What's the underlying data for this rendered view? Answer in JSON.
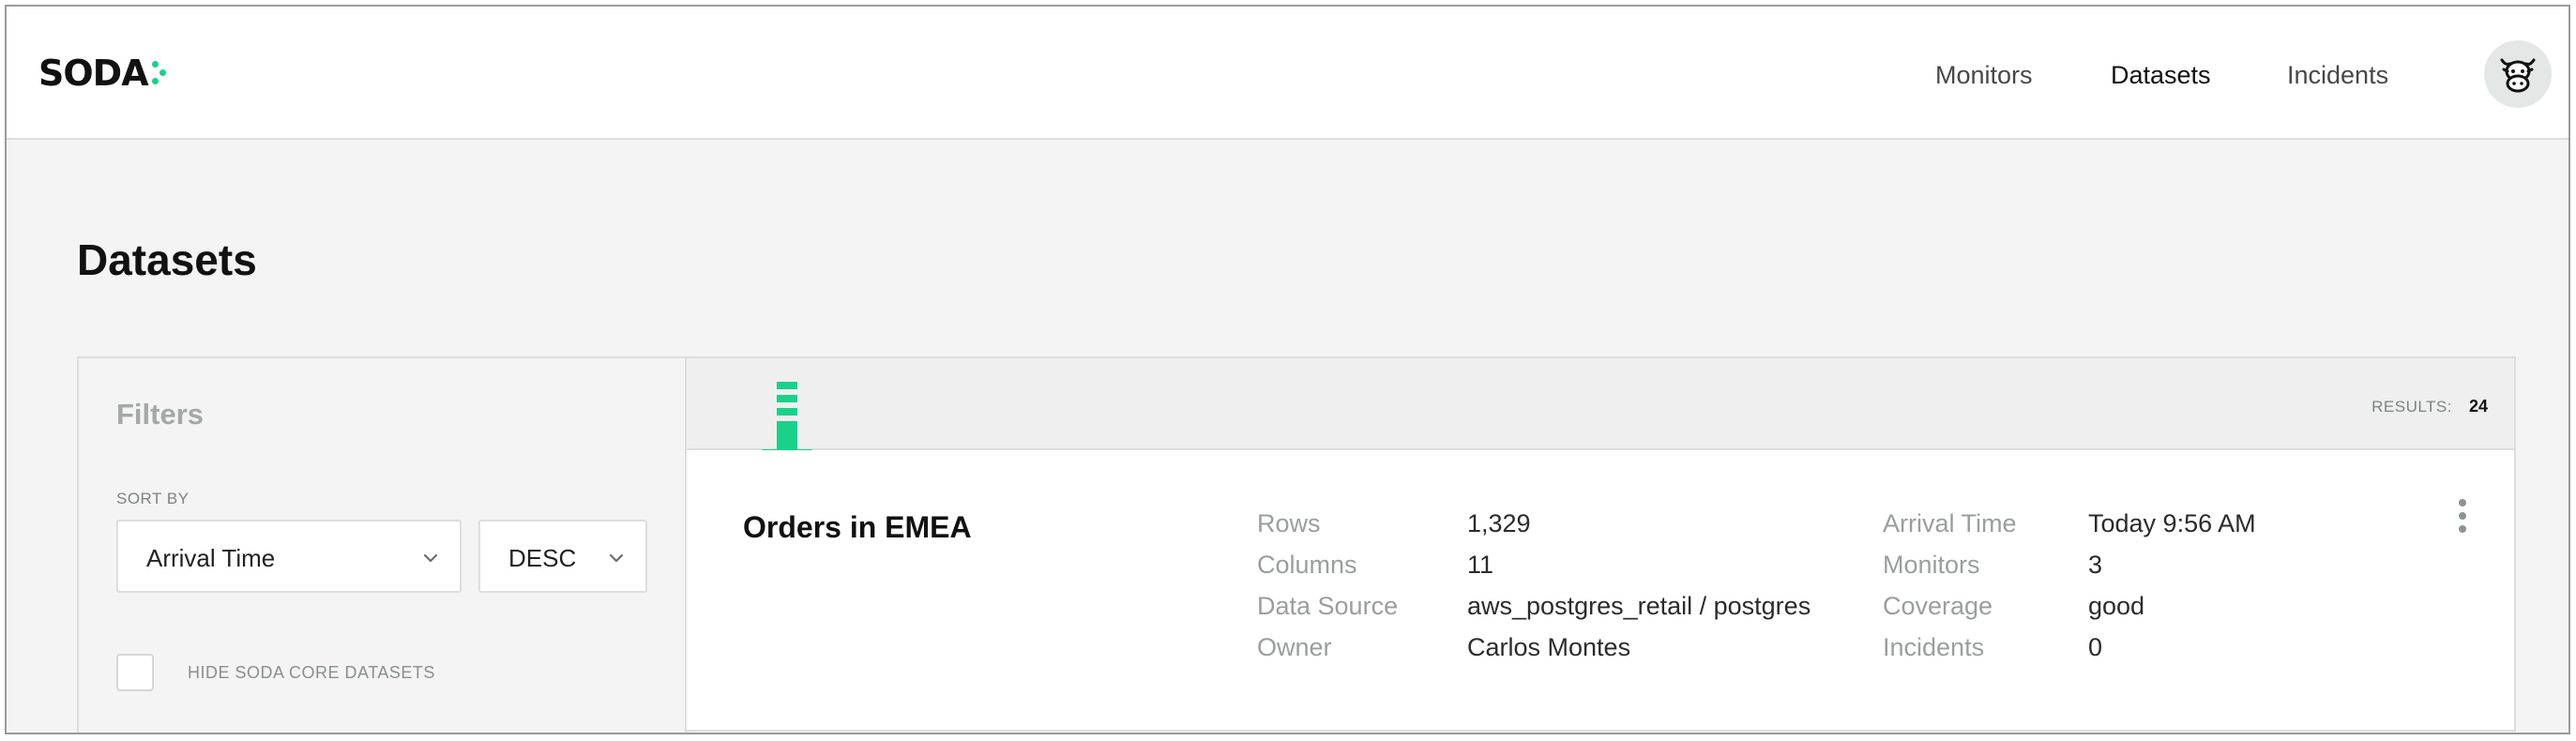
{
  "brand": {
    "name": "SODA",
    "accent": "#19d18b"
  },
  "nav": {
    "items": [
      {
        "label": "Monitors",
        "active": false
      },
      {
        "label": "Datasets",
        "active": true
      },
      {
        "label": "Incidents",
        "active": false
      }
    ],
    "avatar_icon": "cow-icon"
  },
  "page": {
    "title": "Datasets"
  },
  "filters": {
    "title": "Filters",
    "sort_label": "SORT BY",
    "sort_field": "Arrival Time",
    "sort_order": "DESC",
    "hide_core_label": "HIDE SODA CORE DATASETS",
    "hide_core_checked": false
  },
  "results": {
    "label": "RESULTS:",
    "count": "24"
  },
  "datasets": [
    {
      "name": "Orders in EMEA",
      "rows_label": "Rows",
      "rows": "1,329",
      "columns_label": "Columns",
      "columns": "11",
      "source_label": "Data Source",
      "source": "aws_postgres_retail / postgres",
      "owner_label": "Owner",
      "owner": "Carlos Montes",
      "arrival_label": "Arrival Time",
      "arrival": "Today 9:56 AM",
      "monitors_label": "Monitors",
      "monitors": "3",
      "coverage_label": "Coverage",
      "coverage": "good",
      "incidents_label": "Incidents",
      "incidents": "0"
    }
  ],
  "annotation": {
    "icon": "down-arrow-icon",
    "color": "#19d18b"
  }
}
